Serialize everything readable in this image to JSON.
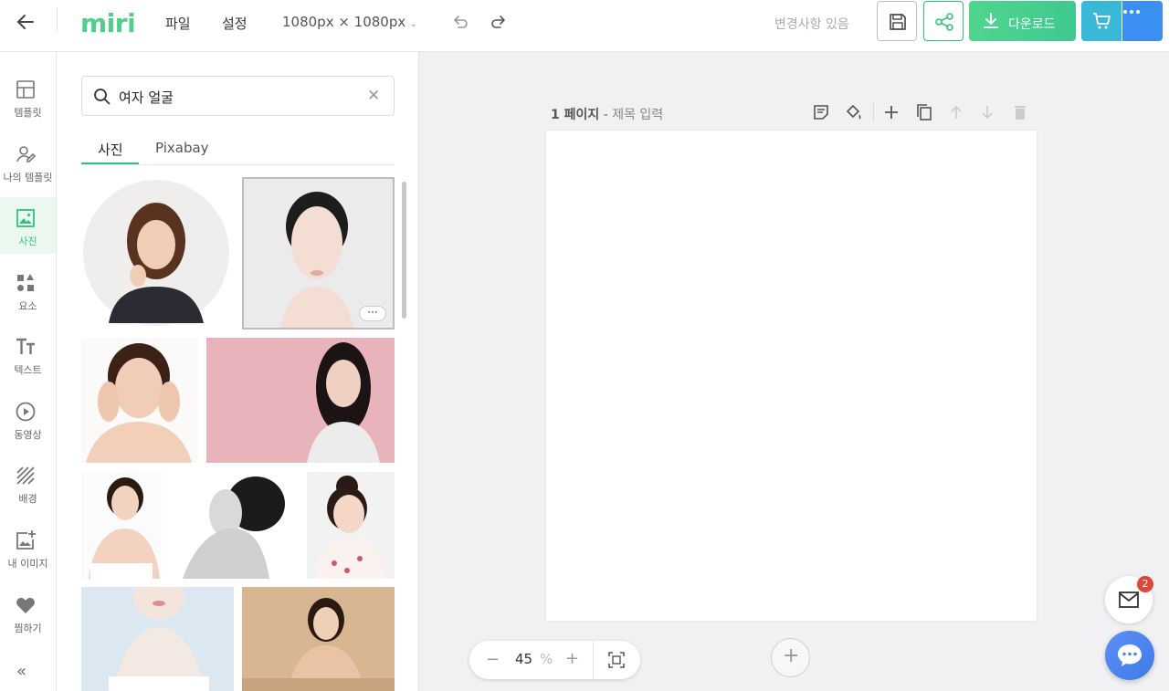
{
  "topbar": {
    "logo": "miri",
    "menu_file": "파일",
    "menu_settings": "설정",
    "canvas_size": "1080px × 1080px",
    "changes_status": "변경사항 있음",
    "download_label": "다운로드"
  },
  "sidebar": {
    "items": [
      {
        "label": "템플릿",
        "icon": "layout-icon"
      },
      {
        "label": "나의 템플릿",
        "icon": "my-template-icon"
      },
      {
        "label": "사진",
        "icon": "photo-icon"
      },
      {
        "label": "요소",
        "icon": "elements-icon"
      },
      {
        "label": "텍스트",
        "icon": "text-icon"
      },
      {
        "label": "동영상",
        "icon": "video-icon"
      },
      {
        "label": "배경",
        "icon": "background-icon"
      },
      {
        "label": "내 이미지",
        "icon": "my-image-icon"
      },
      {
        "label": "찜하기",
        "icon": "heart-icon"
      }
    ],
    "active_index": 2,
    "collapse_glyph": "«"
  },
  "panel": {
    "search_value": "여자 얼굴",
    "tabs": [
      "사진",
      "Pixabay"
    ],
    "active_tab": 0,
    "options_glyph": "···"
  },
  "canvas": {
    "page_number": "1 페이지",
    "page_separator": " - ",
    "page_title_placeholder": "제목 입력",
    "zoom_value": "45",
    "zoom_unit": "%",
    "mail_badge": "2"
  },
  "colors": {
    "accent": "#2ec27e",
    "download": "#4fd58d",
    "cart": "#3ab8d8",
    "more": "#3b8ff0"
  }
}
